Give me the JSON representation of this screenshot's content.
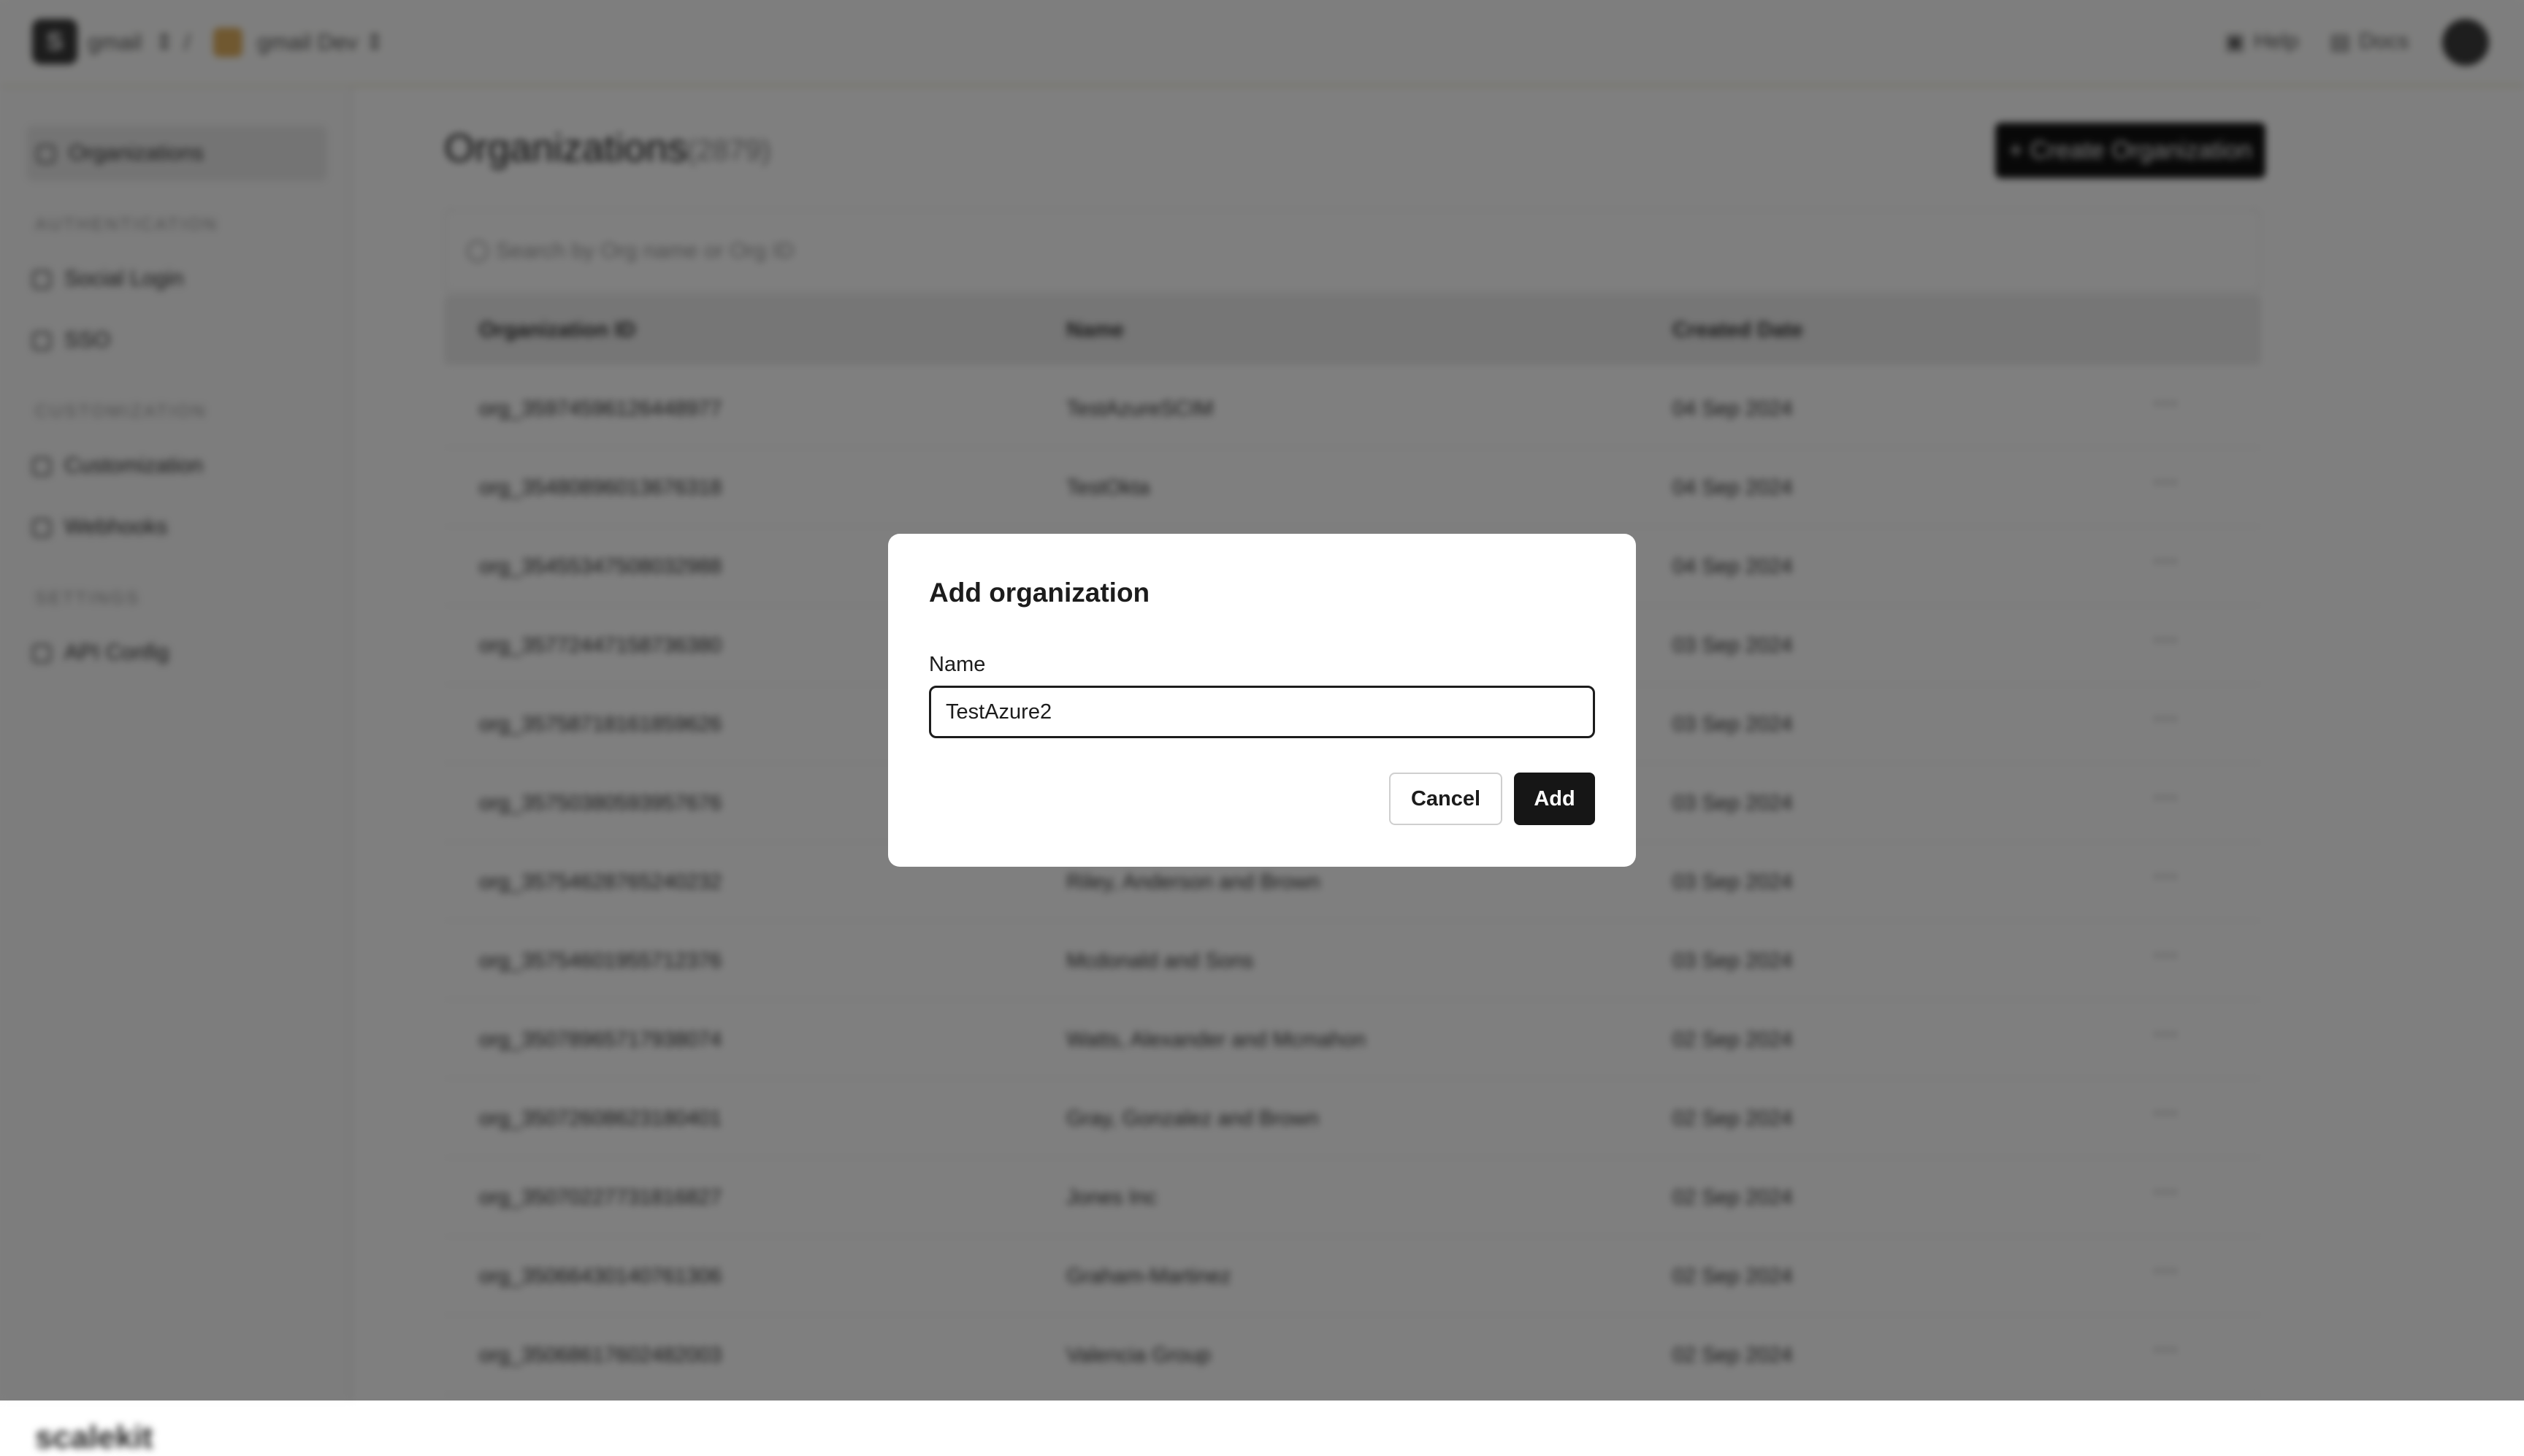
{
  "topbar": {
    "logo_letter": "S",
    "workspace": "gmail",
    "separator": "/",
    "environment": "gmail Dev",
    "help": "Help",
    "docs": "Docs"
  },
  "sidebar": {
    "organizations": "Organizations",
    "sections": [
      {
        "title": "AUTHENTICATION",
        "items": [
          "Social Login",
          "SSO"
        ]
      },
      {
        "title": "CUSTOMIZATION",
        "items": [
          "Customization",
          "Webhooks"
        ]
      },
      {
        "title": "SETTINGS",
        "items": [
          "API Config"
        ]
      }
    ],
    "brand": "scalekit"
  },
  "main": {
    "title": "Organizations",
    "count": "(2879)",
    "create_button": "+ Create Organization",
    "search_placeholder": "Search by Org name or Org ID",
    "columns": [
      "Organization ID",
      "Name",
      "Created Date"
    ],
    "rows": [
      {
        "id": "org_35974596126448977",
        "name": "TestAzureSCIM",
        "date": "04 Sep 2024"
      },
      {
        "id": "org_35480896013676318",
        "name": "TestOkta",
        "date": "04 Sep 2024"
      },
      {
        "id": "org_35455347508032988",
        "name": "",
        "date": "04 Sep 2024"
      },
      {
        "id": "org_35772447158736380",
        "name": "",
        "date": "03 Sep 2024"
      },
      {
        "id": "org_35758718161859626",
        "name": "",
        "date": "03 Sep 2024"
      },
      {
        "id": "org_35750380593957676",
        "name": "",
        "date": "03 Sep 2024"
      },
      {
        "id": "org_35754628765240232",
        "name": "Riley, Anderson and Brown",
        "date": "03 Sep 2024"
      },
      {
        "id": "org_35754601955712376",
        "name": "Mcdonald and Sons",
        "date": "03 Sep 2024"
      },
      {
        "id": "org_35078965717938074",
        "name": "Watts, Alexander and Mcmahon",
        "date": "02 Sep 2024"
      },
      {
        "id": "org_35072608623180401",
        "name": "Gray, Gonzalez and Brown",
        "date": "02 Sep 2024"
      },
      {
        "id": "org_35070227731816827",
        "name": "Jones Inc",
        "date": "02 Sep 2024"
      },
      {
        "id": "org_35066430140761306",
        "name": "Graham-Martinez",
        "date": "02 Sep 2024"
      },
      {
        "id": "org_35068617602482003",
        "name": "Valencia Group",
        "date": "02 Sep 2024"
      }
    ],
    "row_menu_glyph": "⋯"
  },
  "modal": {
    "title": "Add organization",
    "name_label": "Name",
    "name_value": "TestAzure2",
    "cancel_label": "Cancel",
    "add_label": "Add"
  }
}
